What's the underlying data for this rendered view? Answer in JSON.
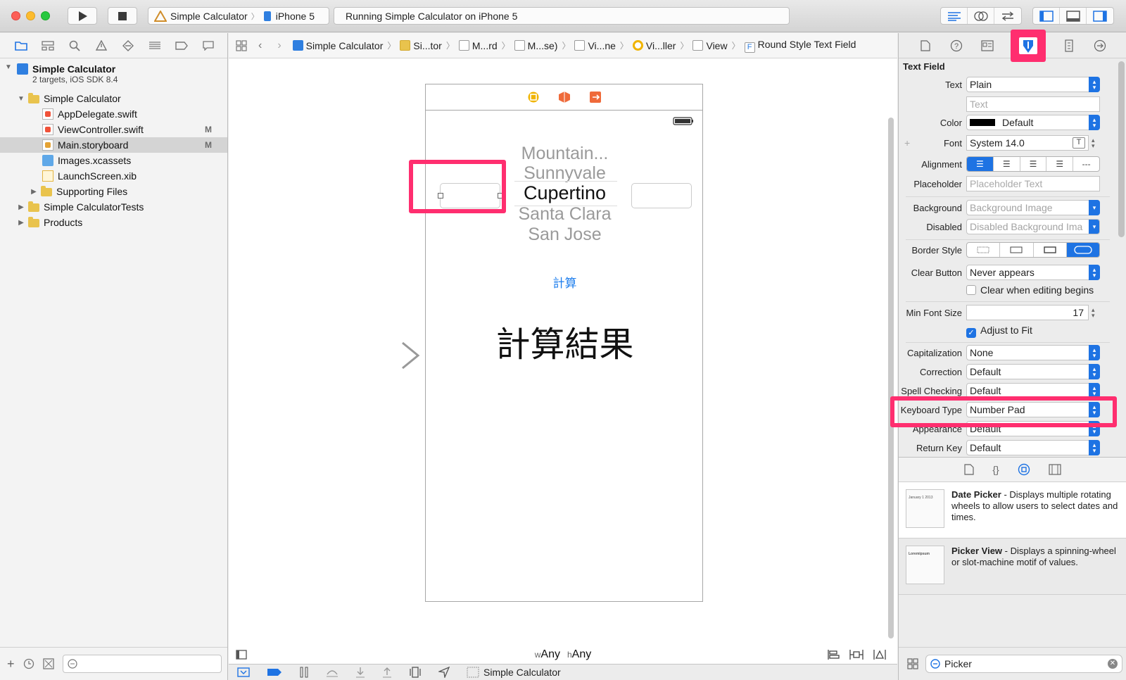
{
  "toolbar": {
    "scheme_app": "Simple Calculator",
    "scheme_device": "iPhone 5",
    "status": "Running Simple Calculator on iPhone 5"
  },
  "navigator": {
    "project_name": "Simple Calculator",
    "project_sub": "2 targets, iOS SDK 8.4",
    "items": [
      {
        "label": "Simple Calculator"
      },
      {
        "label": "AppDelegate.swift"
      },
      {
        "label": "ViewController.swift",
        "flag": "M"
      },
      {
        "label": "Main.storyboard",
        "flag": "M"
      },
      {
        "label": "Images.xcassets"
      },
      {
        "label": "LaunchScreen.xib"
      },
      {
        "label": "Supporting Files"
      },
      {
        "label": "Simple CalculatorTests"
      },
      {
        "label": "Products"
      }
    ]
  },
  "jumpbar": {
    "crumbs": [
      "Simple Calculator",
      "Si...tor",
      "M...rd",
      "M...se)",
      "Vi...ne",
      "Vi...ller",
      "View",
      "Round Style Text Field"
    ]
  },
  "storyboard": {
    "picker_items": [
      "Mountain...",
      "Sunnyvale",
      "Cupertino",
      "Santa Clara",
      "San Jose"
    ],
    "calc_button": "計算",
    "result_label": "計算結果",
    "size_class_w": "w",
    "size_class_w_val": "Any",
    "size_class_h": "h",
    "size_class_h_val": "Any"
  },
  "debug_bar": {
    "target": "Simple Calculator"
  },
  "inspector": {
    "section_title": "Text Field",
    "text_label": "Text",
    "text_value": "Plain",
    "text_placeholder": "Text",
    "color_label": "Color",
    "color_value": "Default",
    "font_label": "Font",
    "font_value": "System 14.0",
    "alignment_label": "Alignment",
    "placeholder_label": "Placeholder",
    "placeholder_value": "Placeholder Text",
    "background_label": "Background",
    "background_value": "Background Image",
    "disabled_label": "Disabled",
    "disabled_value": "Disabled Background Ima",
    "border_label": "Border Style",
    "clear_label": "Clear Button",
    "clear_value": "Never appears",
    "clear_editing_label": "Clear when editing begins",
    "minfont_label": "Min Font Size",
    "minfont_value": "17",
    "adjust_label": "Adjust to Fit",
    "cap_label": "Capitalization",
    "cap_value": "None",
    "correction_label": "Correction",
    "correction_value": "Default",
    "spell_label": "Spell Checking",
    "spell_value": "Default",
    "keyboard_label": "Keyboard Type",
    "keyboard_value": "Number Pad",
    "appearance_label": "Appearance",
    "appearance_value": "Default",
    "return_label": "Return Key",
    "return_value": "Default"
  },
  "library": {
    "items": [
      {
        "title": "Date Picker",
        "desc": " - Displays multiple rotating wheels to allow users to select dates and times.",
        "thumb": "January 1 2013"
      },
      {
        "title": "Picker View",
        "desc": " - Displays a spinning-wheel or slot-machine motif of values.",
        "thumb": "Loremipsum"
      }
    ],
    "search_value": "Picker"
  },
  "colors": {
    "highlight": "#ff2e6f",
    "accent": "#1e73e3"
  }
}
